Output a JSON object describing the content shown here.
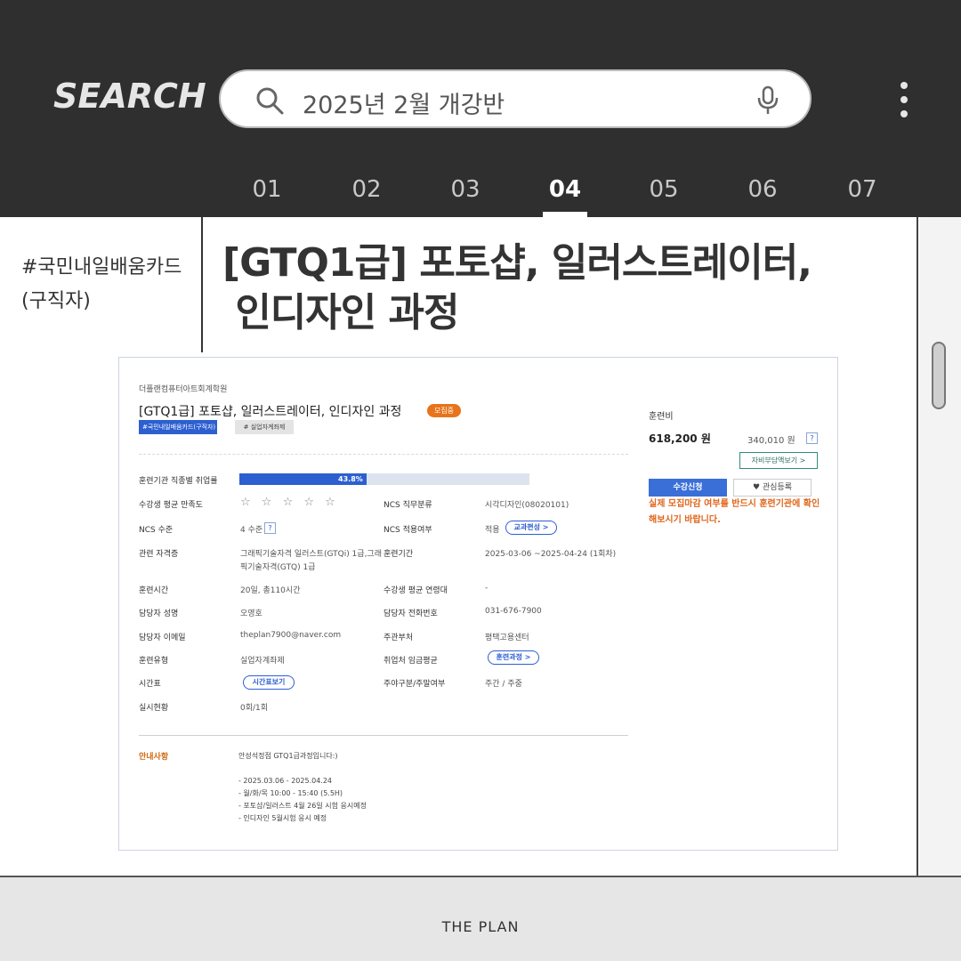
{
  "header": {
    "brand": "SEARCH",
    "search_query": "2025년 2월 개강반",
    "tabs": [
      "01",
      "02",
      "03",
      "04",
      "05",
      "06",
      "07"
    ],
    "active_tab": "04"
  },
  "post": {
    "tag_line1": "#국민내일배움카드",
    "tag_line2": "(구직자)",
    "title_line1": "[GTQ1급] 포토샵, 일러스트레이터,",
    "title_line2": " 인디자인 과정"
  },
  "course": {
    "academy": "더플랜컴퓨터아트회계학원",
    "title": "[GTQ1급] 포토샵, 일러스트레이터, 인디자인 과정",
    "status_badge": "모집중",
    "tags": [
      "#국민내일배움카드(구직자)",
      "# 실업자계좌제"
    ],
    "employment_rate_label": "훈련기관 직종별 취업률",
    "employment_rate_text": "43.8%",
    "employment_rate": 0.438,
    "rows_left": [
      {
        "label": "수강생 평균 만족도",
        "value": "☆ ☆ ☆ ☆ ☆"
      },
      {
        "label": "NCS 수준",
        "value": "4 수준"
      },
      {
        "label": "관련 자격증",
        "value": "그래픽기술자격 일러스트(GTQi) 1급,그래",
        "value2": "픽기술자격(GTQ) 1급"
      },
      {
        "label": "훈련시간",
        "value": "20일, 총110시간"
      },
      {
        "label": "담당자 성명",
        "value": "오영호"
      },
      {
        "label": "담당자 이메일",
        "value": "theplan7900@naver.com"
      },
      {
        "label": "훈련유형",
        "value": "실업자계좌제"
      },
      {
        "label": "시간표",
        "value": "시간표보기"
      },
      {
        "label": "실시현황",
        "value": "0회/1회"
      }
    ],
    "rows_right": [
      {
        "label": "NCS 직무분류",
        "value": "시각디자인(08020101)"
      },
      {
        "label": "NCS 적용여부",
        "value": "적용",
        "pill": "교과편성 >"
      },
      {
        "label": "훈련기간",
        "value": "2025-03-06 ~2025-04-24 (1회차)"
      },
      {
        "label": "수강생 평균 연령대",
        "value": "-"
      },
      {
        "label": "담당자 전화번호",
        "value": "031-676-7900"
      },
      {
        "label": "주관부처",
        "value": "평택고용센터"
      },
      {
        "label": "취업처 임금평균",
        "pill": "훈련과정 >"
      },
      {
        "label": "주야구분/주말여부",
        "value": "주간 / 주중"
      }
    ],
    "notice_label": "안내사항",
    "notice_lines": [
      "안성석정점 GTQ1급과정입니다:)",
      "",
      "- 2025.03.06 - 2025.04.24",
      "- 월/화/목 10:00 - 15:40 (5.5H)",
      "- 포토샵/일러스트 4월 26일 시험 응시예정",
      "- 인디자인 5월시험 응시 예정"
    ],
    "fee_label": "훈련비",
    "fee": "618,200 원",
    "self_pay": "340,010 원",
    "qmark": "?",
    "self_pay_button": "자비부담액보기 >",
    "apply_button": "수강신청",
    "favorite_button": "관심등록",
    "warning": "실제 모집마감 여부를 반드시 훈련기관에 확인해보시기 바랍니다."
  },
  "footer": {
    "text": "THE PLAN"
  },
  "colors": {
    "header_bg": "#2f2f2f",
    "accent_blue": "#2d5fd0",
    "badge_orange": "#e8731a",
    "warning_orange": "#e0661a"
  }
}
